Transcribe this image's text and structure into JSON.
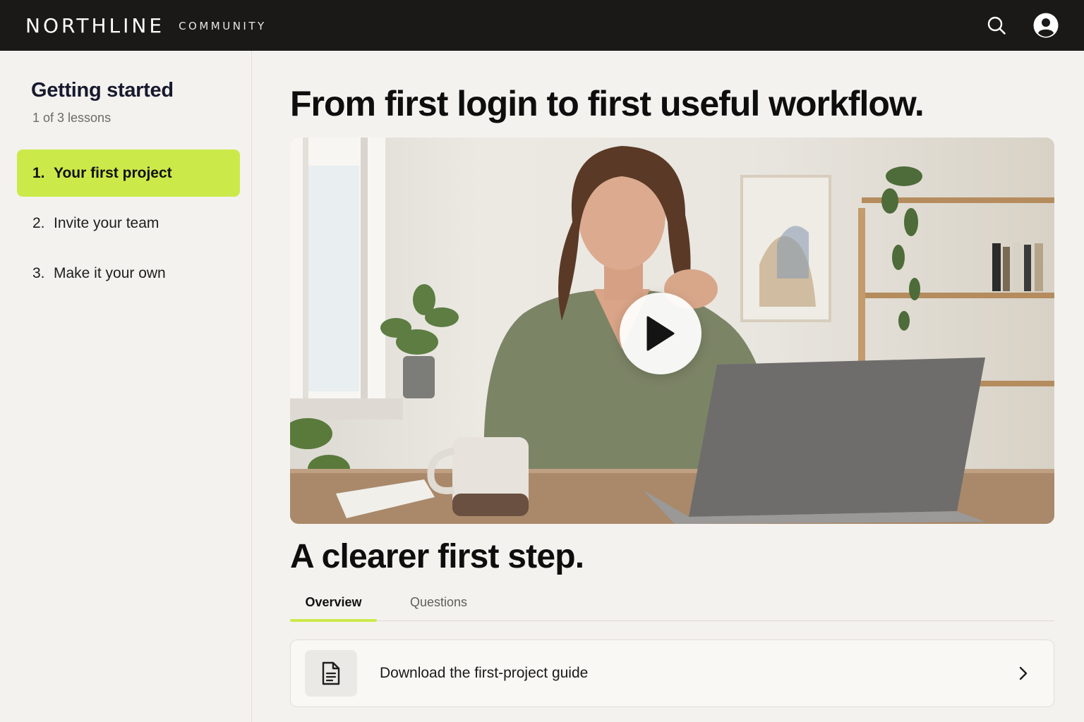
{
  "header": {
    "brand": "NORTHLINE",
    "brand_sub": "COMMUNITY",
    "icons": [
      "search-icon",
      "user-account-icon"
    ]
  },
  "sidebar": {
    "title": "Getting started",
    "progress": "1 of 3 lessons",
    "lessons": [
      {
        "num": "1.",
        "label": "Your first project",
        "active": true
      },
      {
        "num": "2.",
        "label": "Invite your team",
        "active": false
      },
      {
        "num": "3.",
        "label": "Make it your own",
        "active": false
      }
    ]
  },
  "main": {
    "title": "From first login to first useful workflow.",
    "video": {
      "icon": "play-icon"
    },
    "section_title": "A clearer first step.",
    "tabs": [
      {
        "label": "Overview",
        "active": true
      },
      {
        "label": "Questions",
        "active": false
      }
    ],
    "download": {
      "label": "Download the first-project guide",
      "icon": "document-icon",
      "chevron": "chevron-right-icon"
    }
  },
  "colors": {
    "accent": "#cbea4a",
    "topbar": "#1a1917",
    "background": "#f4f2ee"
  }
}
